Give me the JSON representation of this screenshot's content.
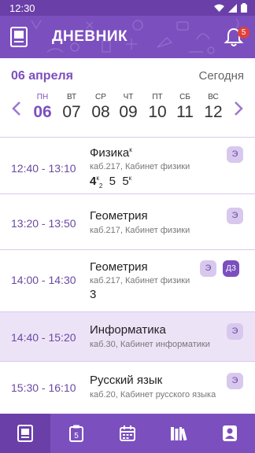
{
  "status_bar": {
    "time": "12:30"
  },
  "app_bar": {
    "title": "ДНЕВНИК",
    "notification_count": "5"
  },
  "date_bar": {
    "date_label": "06 апреля",
    "today_label": "Сегодня",
    "days": [
      {
        "name": "ПН",
        "num": "06",
        "active": true
      },
      {
        "name": "ВТ",
        "num": "07"
      },
      {
        "name": "СР",
        "num": "08"
      },
      {
        "name": "ЧТ",
        "num": "09"
      },
      {
        "name": "ПТ",
        "num": "10"
      },
      {
        "name": "СБ",
        "num": "11"
      },
      {
        "name": "ВС",
        "num": "12"
      }
    ]
  },
  "lessons": [
    {
      "time": "12:40 - 13:10",
      "subject": "Физика",
      "subject_mark": "к",
      "room": "каб.217, Кабинет физики",
      "marks": [
        {
          "v": "4",
          "sup": "к",
          "sub": "2"
        },
        {
          "v": "5"
        },
        {
          "v": "5",
          "sup": "к"
        }
      ],
      "chips": [
        "Э"
      ]
    },
    {
      "time": "13:20 - 13:50",
      "subject": "Геометрия",
      "room": "каб.217, Кабинет физики",
      "chips": [
        "Э"
      ]
    },
    {
      "time": "14:00 - 14:30",
      "subject": "Геометрия",
      "room": "каб.217, Кабинет физики",
      "marks": [
        {
          "v": "3"
        }
      ],
      "chips": [
        "Э",
        "ДЗ"
      ]
    },
    {
      "time": "14:40 - 15:20",
      "subject": "Информатика",
      "room": "каб.30, Кабинет информатики",
      "chips": [
        "Э"
      ],
      "selected": true
    },
    {
      "time": "15:30 - 16:10",
      "subject": "Русский язык",
      "room": "каб.20, Кабинет русского языка",
      "chips": [
        "Э"
      ]
    }
  ],
  "bottom_nav": [
    {
      "icon": "diary-icon",
      "active": true
    },
    {
      "icon": "grades-icon"
    },
    {
      "icon": "calendar-icon"
    },
    {
      "icon": "library-icon"
    },
    {
      "icon": "profile-icon"
    }
  ]
}
